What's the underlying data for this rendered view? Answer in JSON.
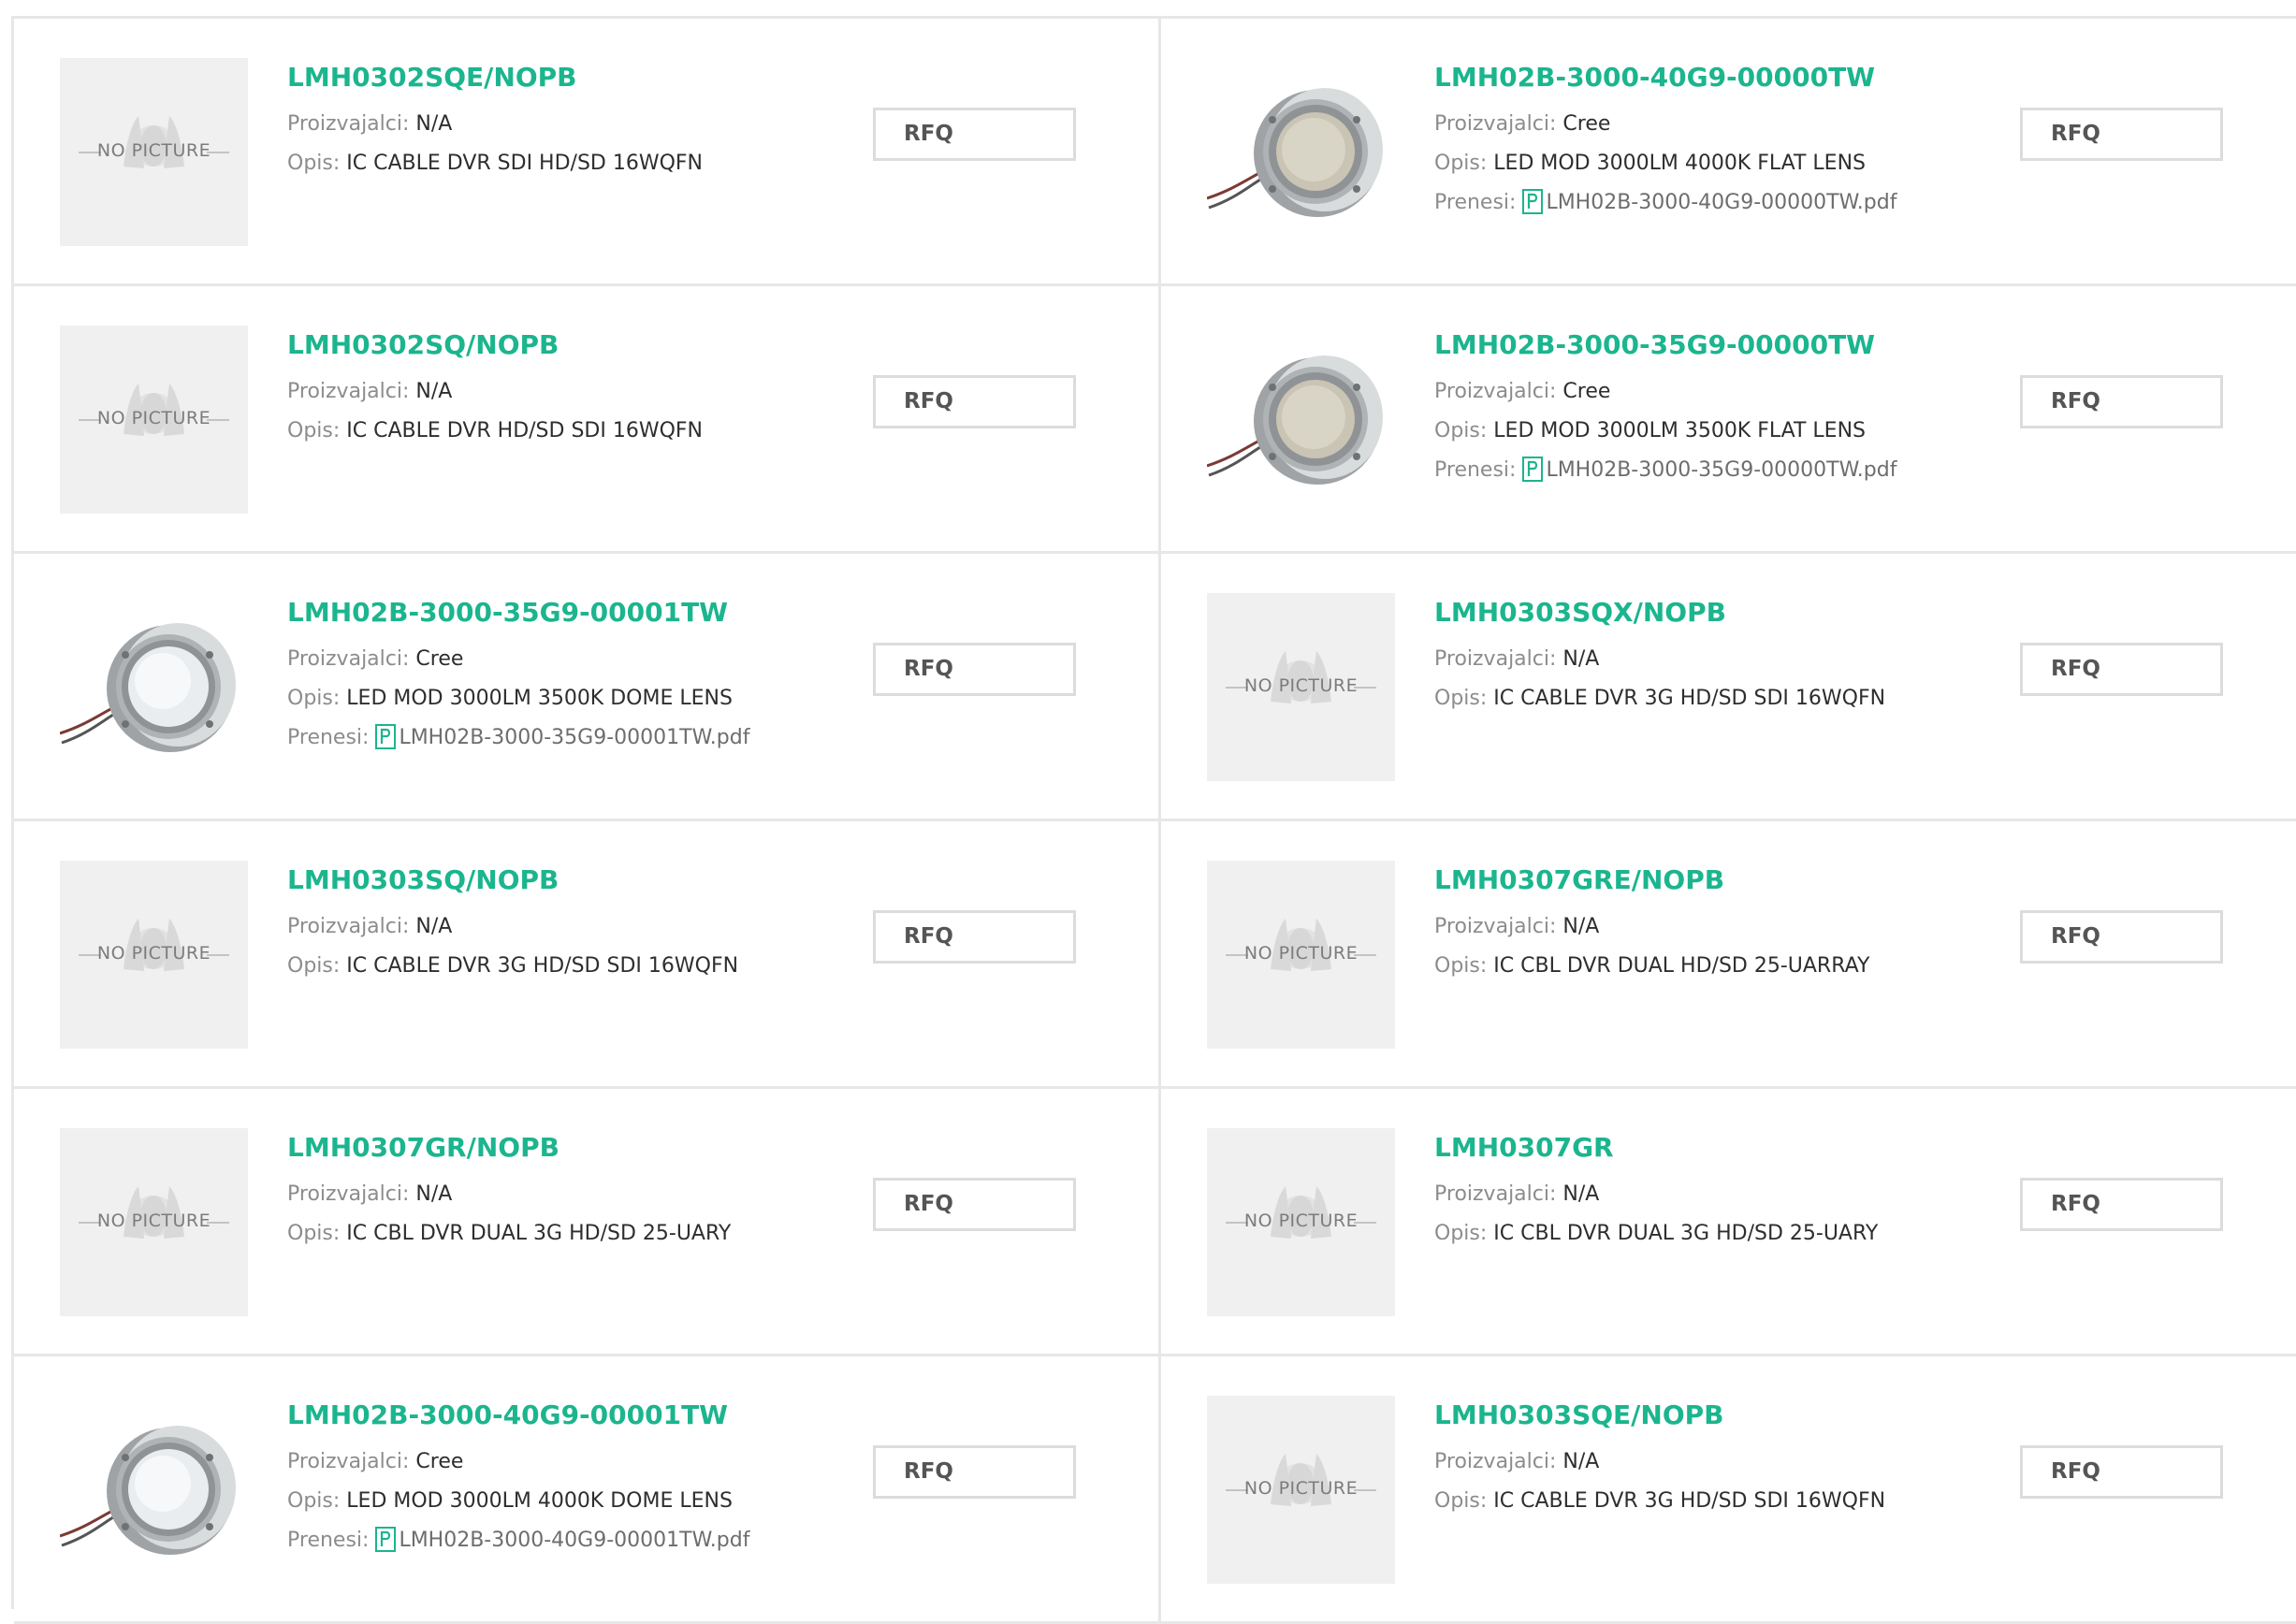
{
  "labels": {
    "manufacturer": "Proizvajalci:",
    "description": "Opis:",
    "download": "Prenesi:",
    "rfq": "RFQ",
    "no_picture": "NO PICTURE"
  },
  "colors": {
    "part_number": "#1bb58e",
    "border": "#e7e7e7",
    "pdf_icon": "#1bb58e"
  },
  "products": [
    {
      "part": "LMH0302SQE/NOPB",
      "manufacturer": "N/A",
      "description": "IC CABLE DVR SDI HD/SD 16WQFN",
      "image": "no-picture"
    },
    {
      "part": "LMH02B-3000-40G9-00000TW",
      "manufacturer": "Cree",
      "description": "LED MOD 3000LM 4000K FLAT LENS",
      "download": "LMH02B-3000-40G9-00000TW.pdf",
      "image": "led-flat-lens-module"
    },
    {
      "part": "LMH0302SQ/NOPB",
      "manufacturer": "N/A",
      "description": "IC CABLE DVR HD/SD SDI 16WQFN",
      "image": "no-picture"
    },
    {
      "part": "LMH02B-3000-35G9-00000TW",
      "manufacturer": "Cree",
      "description": "LED MOD 3000LM 3500K FLAT LENS",
      "download": "LMH02B-3000-35G9-00000TW.pdf",
      "image": "led-flat-lens-module"
    },
    {
      "part": "LMH02B-3000-35G9-00001TW",
      "manufacturer": "Cree",
      "description": "LED MOD 3000LM 3500K DOME LENS",
      "download": "LMH02B-3000-35G9-00001TW.pdf",
      "image": "led-dome-lens-module"
    },
    {
      "part": "LMH0303SQX/NOPB",
      "manufacturer": "N/A",
      "description": "IC CABLE DVR 3G HD/SD SDI 16WQFN",
      "image": "no-picture"
    },
    {
      "part": "LMH0303SQ/NOPB",
      "manufacturer": "N/A",
      "description": "IC CABLE DVR 3G HD/SD SDI 16WQFN",
      "image": "no-picture"
    },
    {
      "part": "LMH0307GRE/NOPB",
      "manufacturer": "N/A",
      "description": "IC CBL DVR DUAL HD/SD 25-UARRAY",
      "image": "no-picture"
    },
    {
      "part": "LMH0307GR/NOPB",
      "manufacturer": "N/A",
      "description": "IC CBL DVR DUAL 3G HD/SD 25-UARY",
      "image": "no-picture"
    },
    {
      "part": "LMH0307GR",
      "manufacturer": "N/A",
      "description": "IC CBL DVR DUAL 3G HD/SD 25-UARY",
      "image": "no-picture"
    },
    {
      "part": "LMH02B-3000-40G9-00001TW",
      "manufacturer": "Cree",
      "description": "LED MOD 3000LM 4000K DOME LENS",
      "download": "LMH02B-3000-40G9-00001TW.pdf",
      "image": "led-dome-lens-module"
    },
    {
      "part": "LMH0303SQE/NOPB",
      "manufacturer": "N/A",
      "description": "IC CABLE DVR 3G HD/SD SDI 16WQFN",
      "image": "no-picture"
    }
  ]
}
